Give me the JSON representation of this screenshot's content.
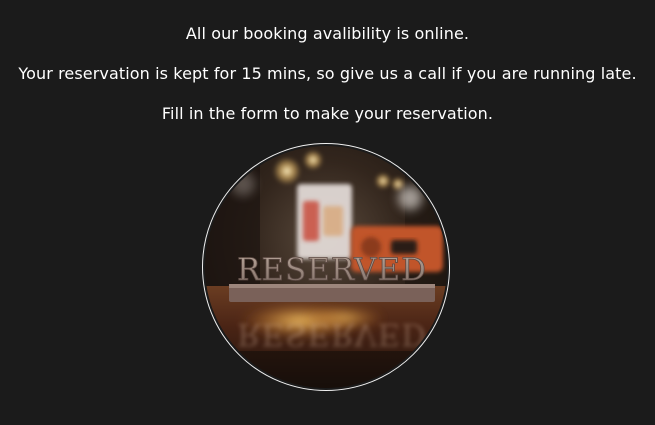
{
  "intro": {
    "line1": "All our booking avalibility is online.",
    "line2": "Your reservation is kept for 15 mins, so give us a call if you are running late.",
    "line3": "Fill in the form to make your reservation."
  },
  "image": {
    "sign_text": "RESERVED",
    "border_color": "#f0f0f0",
    "background_color": "#1b1b1b"
  }
}
